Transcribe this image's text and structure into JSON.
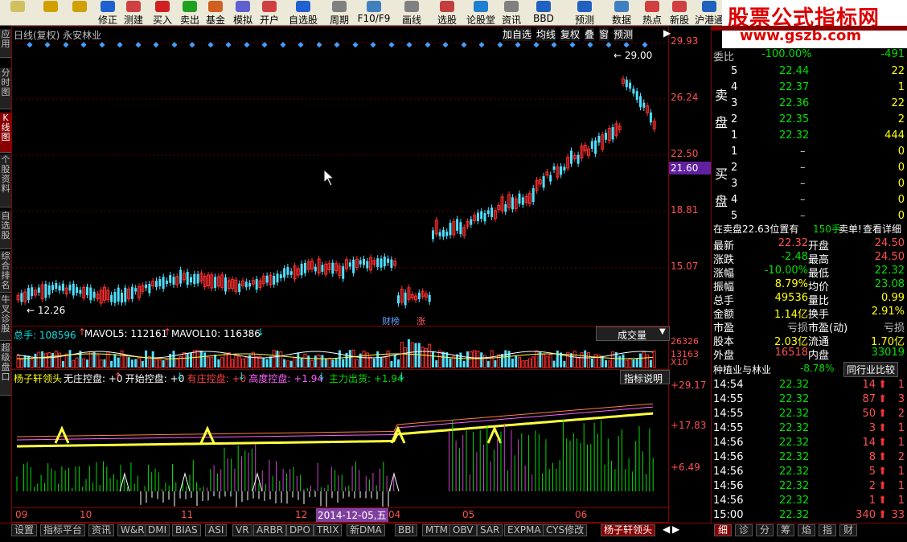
{
  "toolbar": {
    "buttons": [
      {
        "label": "",
        "color": "#d0c060"
      },
      {
        "label": "",
        "color": "#d0a000"
      },
      {
        "label": "",
        "color": "#d0a000"
      },
      {
        "label": "修正",
        "color": "#2060d0"
      },
      {
        "label": "测建",
        "color": "#d04040"
      },
      {
        "label": "买入",
        "color": "#d02020"
      },
      {
        "label": "卖出",
        "color": "#20a020"
      },
      {
        "label": "基金",
        "color": "#d06020"
      },
      {
        "label": "模拟",
        "color": "#6060d0"
      },
      {
        "label": "开户",
        "color": "#d04040"
      },
      {
        "label": "自选股",
        "color": "#2060d0"
      },
      {
        "label": "周期",
        "color": "#808080"
      },
      {
        "label": "F10/F9",
        "color": "#4080c0"
      },
      {
        "label": "画线",
        "color": "#808080"
      },
      {
        "label": "选股",
        "color": "#c04040"
      },
      {
        "label": "论股堂",
        "color": "#2080d0"
      },
      {
        "label": "资讯",
        "color": "#808080"
      },
      {
        "label": "BBD",
        "color": "#2060c0"
      },
      {
        "label": "预测",
        "color": "#2060c0"
      },
      {
        "label": "数据",
        "color": "#4080c0"
      },
      {
        "label": "热点",
        "color": "#d04040"
      },
      {
        "label": "新股",
        "color": "#d04040"
      },
      {
        "label": "沪港通",
        "color": "#2060c0"
      }
    ],
    "watermark_title": "股票公式指标网",
    "watermark_url": "www.gszb.com"
  },
  "left_tabs": [
    {
      "label": "应用",
      "active": false
    },
    {
      "label": "分时图",
      "active": false
    },
    {
      "label": "K线图",
      "active": true
    },
    {
      "label": "个股资料",
      "active": false
    },
    {
      "label": "自选股",
      "active": false
    },
    {
      "label": "综合排名",
      "active": false
    },
    {
      "label": "牛叉诊股",
      "active": false
    },
    {
      "label": "超级盘口",
      "active": false
    }
  ],
  "chart": {
    "header": "日线(复权) 永安林业",
    "header_buttons": [
      "加自选",
      "均线",
      "复权",
      "叠",
      "窗",
      "预测"
    ],
    "high_label": "← 29.00",
    "low_label": "← 12.26",
    "price_axis": [
      "29.93",
      "26.24",
      "22.50",
      "18.81",
      "15.07"
    ],
    "current_price": "21.60",
    "markers": [
      "财榜",
      "涨"
    ],
    "volume_header": {
      "total": "总手: 108596",
      "mavol5": "MAVOL5: 112161",
      "mavol10": "MAVOL10: 116386"
    },
    "volume_dropdown": "成交量",
    "volume_axis": [
      "26326",
      "13163",
      "X10"
    ],
    "indicator_header": {
      "name": "杨子轩领头",
      "items": [
        {
          "label": "无庄控盘: +0",
          "color": "#ffffff"
        },
        {
          "label": "开始控盘: +0",
          "color": "#ffffff"
        },
        {
          "label": "有庄控盘: +0",
          "color": "#ff4040"
        },
        {
          "label": "高度控盘: +1.94",
          "color": "#ff60ff"
        },
        {
          "label": "主力出货: +1.94",
          "color": "#00e000"
        }
      ]
    },
    "indicator_button": "指标说明",
    "indicator_axis": [
      "+29.17",
      "+17.83",
      "+6.49"
    ],
    "date_axis": [
      "09",
      "10",
      "11",
      "12",
      "04",
      "05",
      "06"
    ],
    "date_highlight": "2014-12-05,五"
  },
  "quote": {
    "weibi_label": "委比",
    "weibi_pct": "-100.00%",
    "weibi_val": "-491",
    "sell_label": "卖盘",
    "buy_label": "买盘",
    "sells": [
      {
        "n": "5",
        "p": "22.44",
        "v": "22"
      },
      {
        "n": "4",
        "p": "22.37",
        "v": "1"
      },
      {
        "n": "3",
        "p": "22.36",
        "v": "22"
      },
      {
        "n": "2",
        "p": "22.35",
        "v": "2"
      },
      {
        "n": "1",
        "p": "22.32",
        "v": "444"
      }
    ],
    "buys": [
      {
        "n": "1",
        "p": "–",
        "v": "0"
      },
      {
        "n": "2",
        "p": "–",
        "v": "0"
      },
      {
        "n": "3",
        "p": "–",
        "v": "0"
      },
      {
        "n": "4",
        "p": "–",
        "v": "0"
      },
      {
        "n": "5",
        "p": "–",
        "v": "0"
      }
    ],
    "notice": "在卖盘22.63位置有",
    "notice_hand": "150手",
    "notice_sell": "卖单!",
    "notice_link": "查看详细",
    "stats": [
      {
        "l1": "最新",
        "v1": "22.32",
        "c1": "#ff5050",
        "l2": "开盘",
        "v2": "24.50",
        "c2": "#ff5050"
      },
      {
        "l1": "涨跌",
        "v1": "-2.48",
        "c1": "#00e000",
        "l2": "最高",
        "v2": "24.50",
        "c2": "#ff5050"
      },
      {
        "l1": "涨幅",
        "v1": "-10.00%",
        "c1": "#00e000",
        "l2": "最低",
        "v2": "22.32",
        "c2": "#00e000"
      },
      {
        "l1": "振幅",
        "v1": "8.79%",
        "c1": "#ffff00",
        "l2": "均价",
        "v2": "23.08",
        "c2": "#00e000"
      },
      {
        "l1": "总手",
        "v1": "49536",
        "c1": "#ffff00",
        "l2": "量比",
        "v2": "0.99",
        "c2": "#ffff00"
      },
      {
        "l1": "金额",
        "v1": "1.14亿",
        "c1": "#ffff00",
        "l2": "换手",
        "v2": "2.91%",
        "c2": "#ffff00"
      },
      {
        "l1": "市盈",
        "v1": "亏损",
        "c1": "#c0c0c0",
        "l2": "市盈(动)",
        "v2": "亏损",
        "c2": "#c0c0c0"
      },
      {
        "l1": "股本",
        "v1": "2.03亿",
        "c1": "#ffff00",
        "l2": "流通",
        "v2": "1.70亿",
        "c2": "#ffff00"
      },
      {
        "l1": "外盘",
        "v1": "16518",
        "c1": "#ff5050",
        "l2": "内盘",
        "v2": "33019",
        "c2": "#00e000"
      }
    ],
    "industry": "种植业与林业",
    "industry_pct": "-8.78%",
    "industry_btn": "同行业比较",
    "ticks": [
      {
        "t": "14:54",
        "p": "22.32",
        "v": "14",
        "d": "1"
      },
      {
        "t": "14:55",
        "p": "22.32",
        "v": "87",
        "d": "3"
      },
      {
        "t": "14:55",
        "p": "22.32",
        "v": "50",
        "d": "2"
      },
      {
        "t": "14:55",
        "p": "22.32",
        "v": "3",
        "d": "1"
      },
      {
        "t": "14:56",
        "p": "22.32",
        "v": "14",
        "d": "1"
      },
      {
        "t": "14:56",
        "p": "22.32",
        "v": "8",
        "d": "2"
      },
      {
        "t": "14:56",
        "p": "22.32",
        "v": "5",
        "d": "1"
      },
      {
        "t": "14:56",
        "p": "22.32",
        "v": "2",
        "d": "1"
      },
      {
        "t": "14:56",
        "p": "22.32",
        "v": "1",
        "d": "1"
      },
      {
        "t": "15:00",
        "p": "22.32",
        "v": "340",
        "d": "33"
      }
    ]
  },
  "bottom_tabs": [
    "设置",
    "指标平台",
    "资讯",
    "W&R",
    "DMI",
    "BIAS",
    "ASI",
    "VR",
    "ARBR",
    "DPO",
    "TRIX",
    "新DMA",
    "BBI",
    "MTM",
    "OBV",
    "SAR",
    "EXPMA",
    "CYS修改",
    "杨子轩领头"
  ],
  "right_tabs": [
    "细",
    "诊",
    "分",
    "筹",
    "焰",
    "指",
    "财"
  ]
}
